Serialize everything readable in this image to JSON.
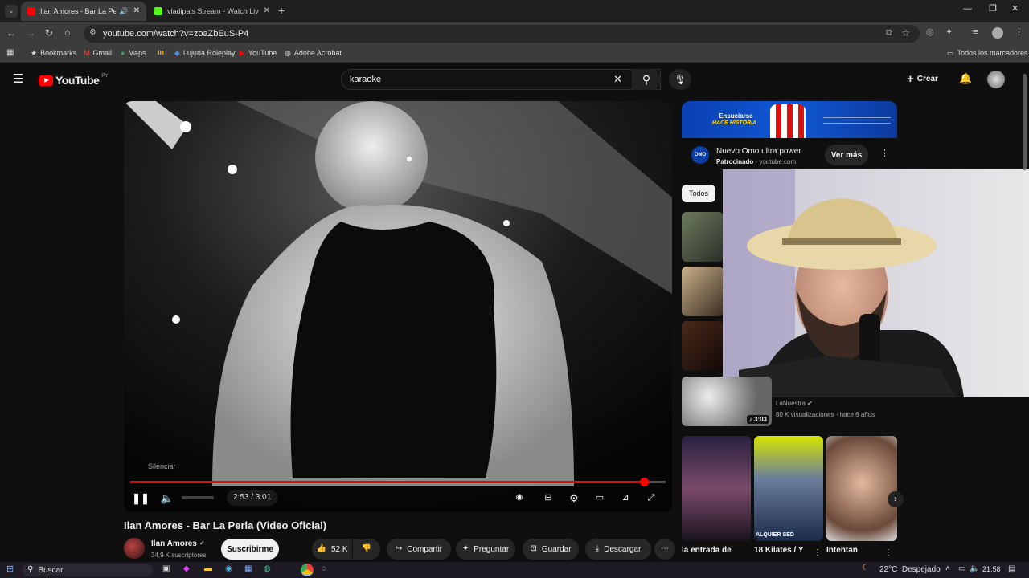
{
  "browser": {
    "tabs": [
      {
        "label": "Ilan Amores - Bar La Perla (V",
        "active": true
      },
      {
        "label": "vladipals Stream - Watch Live o",
        "active": false
      }
    ],
    "url": "youtube.com/watch?v=zoaZbEuS-P4",
    "bookmarks": [
      "Bookmarks",
      "Gmail",
      "Maps",
      "Lujuria Roleplay",
      "YouTube",
      "Adobe Acrobat"
    ],
    "all_bookmarks": "Todos los marcadores"
  },
  "youtube": {
    "logo": "YouTube",
    "region": "PY",
    "search_value": "karaoke",
    "create_label": "Crear"
  },
  "player": {
    "tooltip": "Silenciar",
    "time": "2:53 / 3:01",
    "progress": 0.96
  },
  "video": {
    "title": "Ilan Amores - Bar La Perla (Video Oficial)",
    "channel": "Ilan Amores",
    "subscribers": "34,9 K suscriptores",
    "subscribe": "Suscribirme",
    "likes": "52 K",
    "share": "Compartir",
    "ask": "Preguntar",
    "save": "Guardar",
    "download": "Descargar"
  },
  "ad": {
    "banner_line1": "Ensuciarse",
    "banner_line2": "HACE HISTORIA",
    "title": "Nuevo Omo ultra power",
    "sponsored": "Patrocinado",
    "domain": "youtube.com",
    "cta": "Ver más",
    "logo": "OMO"
  },
  "filter_chip": "Todos",
  "recommended": {
    "channel": "LaNuestra",
    "meta": "80 K visualizaciones · hace 6 años",
    "duration": "3:03"
  },
  "shorts": [
    {
      "title": "la entrada de"
    },
    {
      "title": "18 Kilates / Y"
    },
    {
      "title": "Intentan"
    }
  ],
  "shorts_overlay": "ALQUIER SED",
  "taskbar": {
    "search": "Buscar",
    "weather": "22°C  Despejado",
    "clock": "21:58"
  }
}
